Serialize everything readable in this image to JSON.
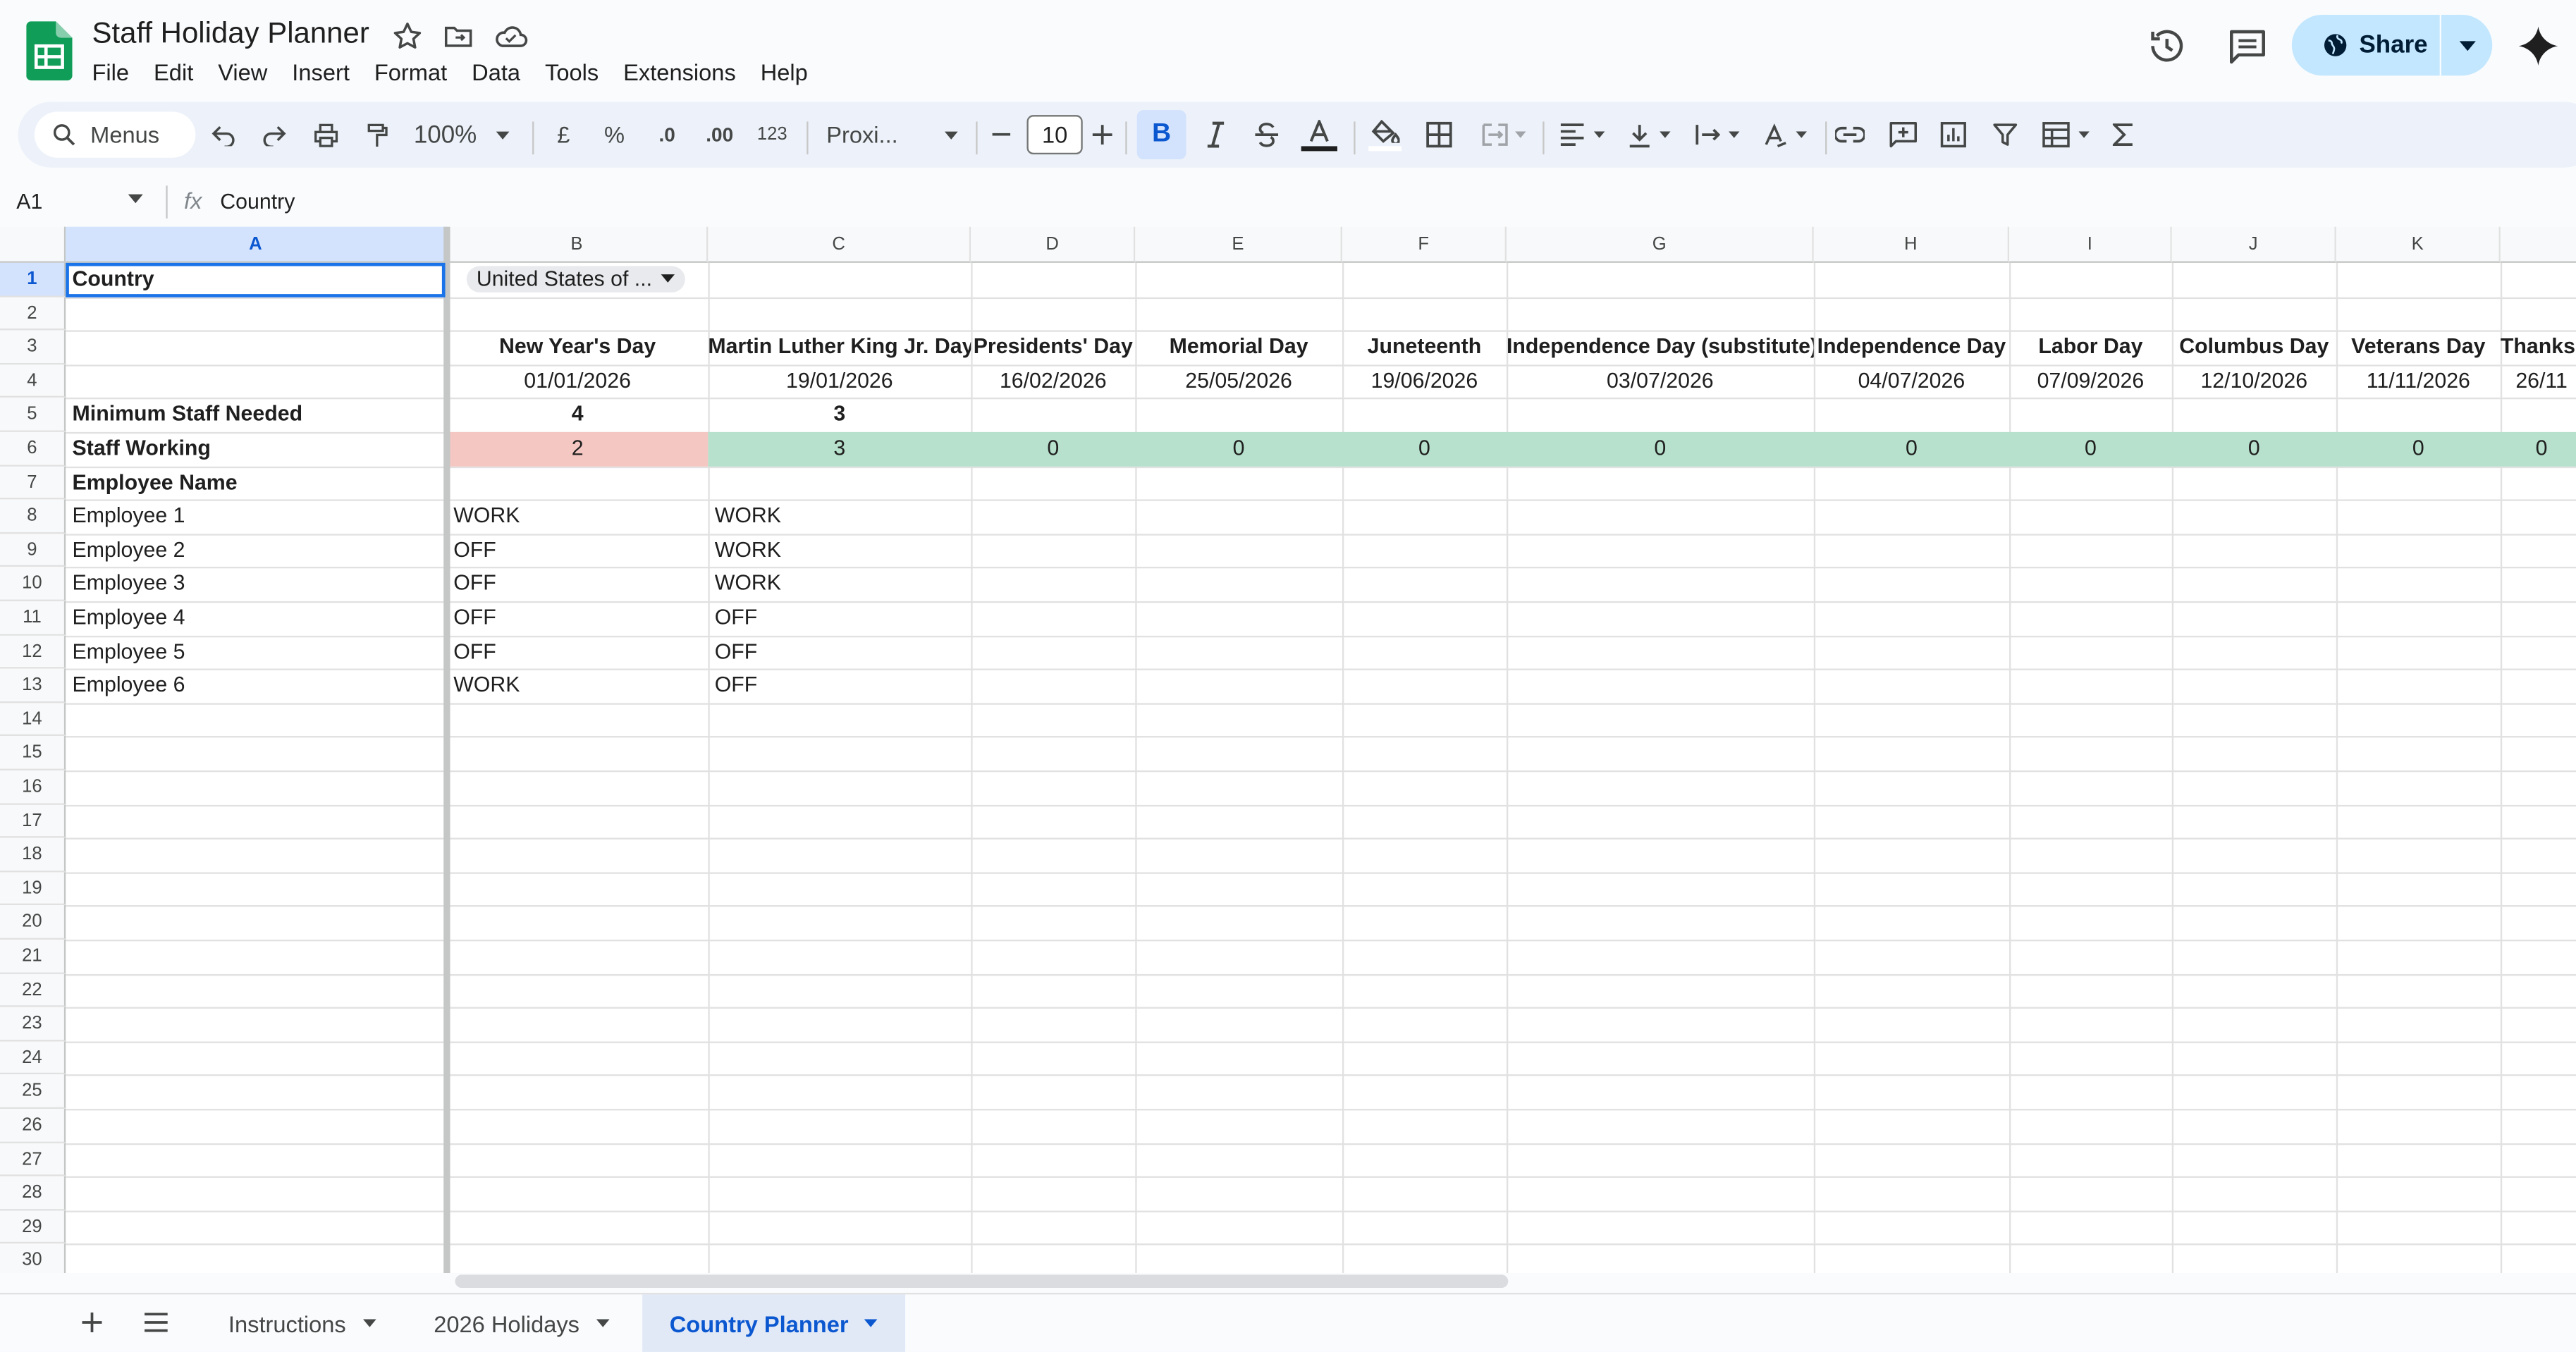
{
  "doc": {
    "title": "Staff Holiday Planner"
  },
  "menu": [
    "File",
    "Edit",
    "View",
    "Insert",
    "Format",
    "Data",
    "Tools",
    "Extensions",
    "Help"
  ],
  "share": {
    "label": "Share"
  },
  "toolbar": {
    "search_label": "Menus",
    "zoom": "100%",
    "currency": "£",
    "percent": "%",
    "dec_decrease": ".0",
    "dec_increase": ".00",
    "number_format": "123",
    "font": "Proxi...",
    "font_size": "10",
    "bold": "B"
  },
  "formula_bar": {
    "cell_ref": "A1",
    "fx": "fx",
    "value": "Country"
  },
  "columns": [
    "A",
    "B",
    "C",
    "D",
    "E",
    "F",
    "G",
    "H",
    "I",
    "J",
    "K"
  ],
  "rows": [
    "1",
    "2",
    "3",
    "4",
    "5",
    "6",
    "7",
    "8",
    "9",
    "10",
    "11",
    "12",
    "13",
    "14",
    "15",
    "16",
    "17",
    "18",
    "19",
    "20",
    "21",
    "22",
    "23",
    "24",
    "25",
    "26",
    "27",
    "28",
    "29",
    "30"
  ],
  "sheet": {
    "a1": "Country",
    "country_dropdown": "United States of ...",
    "a5": "Minimum Staff Needed",
    "a6": "Staff Working",
    "a7": "Employee Name",
    "holidays": [
      "New Year's Day",
      "Martin Luther King Jr. Day",
      "Presidents' Day",
      "Memorial Day",
      "Juneteenth",
      "Independence Day (substitute)",
      "Independence Day",
      "Labor Day",
      "Columbus Day",
      "Veterans Day",
      "Thanksg"
    ],
    "dates": [
      "01/01/2026",
      "19/01/2026",
      "16/02/2026",
      "25/05/2026",
      "19/06/2026",
      "03/07/2026",
      "04/07/2026",
      "07/09/2026",
      "12/10/2026",
      "11/11/2026",
      "26/11"
    ],
    "min_staff": [
      "4",
      "3"
    ],
    "staff_working": [
      "2",
      "3",
      "0",
      "0",
      "0",
      "0",
      "0",
      "0",
      "0",
      "0",
      "0"
    ],
    "employees": [
      {
        "name": "Employee 1",
        "b": "WORK",
        "c": "WORK"
      },
      {
        "name": "Employee 2",
        "b": "OFF",
        "c": "WORK"
      },
      {
        "name": "Employee 3",
        "b": "OFF",
        "c": "WORK"
      },
      {
        "name": "Employee 4",
        "b": "OFF",
        "c": "OFF"
      },
      {
        "name": "Employee 5",
        "b": "OFF",
        "c": "OFF"
      },
      {
        "name": "Employee 6",
        "b": "WORK",
        "c": "OFF"
      }
    ]
  },
  "tabs": [
    "Instructions",
    "2026 Holidays",
    "Country Planner"
  ],
  "colors": {
    "shortfall": "#f4c7c3",
    "ok": "#b7e1cd",
    "active_tab": "#e1e9f7",
    "accent": "#0b57d0",
    "share_bg": "#c2e7ff"
  }
}
